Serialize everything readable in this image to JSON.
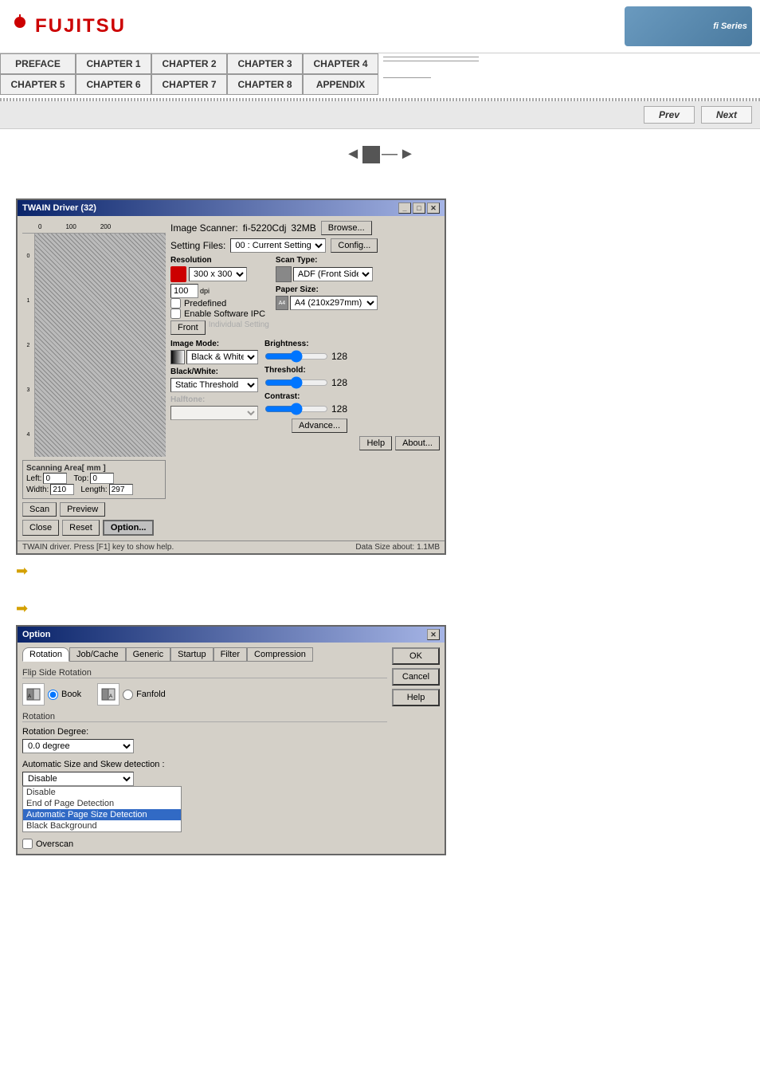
{
  "header": {
    "logo_text": "FUJITSU",
    "series_text": "fi Series"
  },
  "nav": {
    "row1": [
      {
        "label": "PREFACE",
        "id": "preface"
      },
      {
        "label": "CHAPTER 1",
        "id": "ch1"
      },
      {
        "label": "CHAPTER 2",
        "id": "ch2"
      },
      {
        "label": "CHAPTER 3",
        "id": "ch3"
      },
      {
        "label": "CHAPTER 4",
        "id": "ch4"
      }
    ],
    "row2": [
      {
        "label": "CHAPTER 5",
        "id": "ch5"
      },
      {
        "label": "CHAPTER 6",
        "id": "ch6"
      },
      {
        "label": "CHAPTER 7",
        "id": "ch7"
      },
      {
        "label": "CHAPTER 8",
        "id": "ch8"
      },
      {
        "label": "APPENDIX",
        "id": "appendix"
      }
    ]
  },
  "toolbar": {
    "prev_label": "Prev",
    "next_label": "Next"
  },
  "twain_window": {
    "title": "TWAIN Driver (32)",
    "image_scanner_label": "Image Scanner:",
    "image_scanner_value": "fi-5220Cdj",
    "memory_label": "32MB",
    "browse_btn": "Browse...",
    "setting_files_label": "Setting Files:",
    "setting_files_value": "00 : Current Setting",
    "config_btn": "Config...",
    "resolution_label": "Resolution",
    "resolution_value": "300 x 300",
    "dpi_label": "dpi",
    "predefined_label": "Predefined",
    "enable_ipc_label": "Enable Software IPC",
    "front_label": "Front",
    "individual_setting_label": "Individual Setting",
    "scan_type_label": "Scan Type:",
    "scan_type_value": "ADF (Front Side)",
    "paper_size_label": "Paper Size:",
    "paper_size_value": "A4 (210x297mm)",
    "image_mode_label": "Image Mode:",
    "image_mode_value": "Black & White",
    "brightness_label": "Brightness:",
    "brightness_value": "128",
    "black_white_label": "Black/White:",
    "threshold_label": "Threshold:",
    "threshold_value": "128",
    "static_threshold_label": "Static Threshold",
    "halftone_label": "Halftone:",
    "contrast_label": "Contrast:",
    "contrast_value": "128",
    "advance_btn": "Advance...",
    "scan_btn": "Scan",
    "preview_btn": "Preview",
    "close_btn": "Close",
    "reset_btn": "Reset",
    "option_btn": "Option...",
    "help_btn": "Help",
    "about_btn": "About...",
    "statusbar": "TWAIN driver. Press [F1] key to show help.",
    "data_size_label": "Data Size about:",
    "data_size_value": "1.1MB",
    "scanning_area_title": "Scanning Area[ mm ]",
    "left_label": "Left:",
    "left_value": "0",
    "top_label": "Top:",
    "top_value": "0",
    "width_label": "Width:",
    "width_value": "210",
    "length_label": "Length:",
    "length_value": "297",
    "ruler_marks": [
      "0",
      "100",
      "200"
    ]
  },
  "option_window": {
    "title": "Option",
    "tabs": [
      {
        "label": "Rotation",
        "active": true
      },
      {
        "label": "Job/Cache"
      },
      {
        "label": "Generic"
      },
      {
        "label": "Startup"
      },
      {
        "label": "Filter"
      },
      {
        "label": "Compression"
      }
    ],
    "flip_side_section": "Flip Side Rotation",
    "book_label": "Book",
    "fanfold_label": "Fanfold",
    "rotation_section": "Rotation",
    "rotation_degree_label": "Rotation Degree:",
    "rotation_degree_value": "0.0 degree",
    "auto_size_label": "Automatic Size and Skew detection :",
    "disable_label": "Disable",
    "dropdown_items": [
      {
        "label": "Disable",
        "selected": false
      },
      {
        "label": "End of Page Detection",
        "selected": false
      },
      {
        "label": "Automatic Page Size Detection",
        "selected": true
      },
      {
        "label": "Black Background",
        "selected": false
      }
    ],
    "overscan_label": "Overscan",
    "ok_btn": "OK",
    "cancel_btn": "Cancel",
    "help_btn": "Help"
  }
}
